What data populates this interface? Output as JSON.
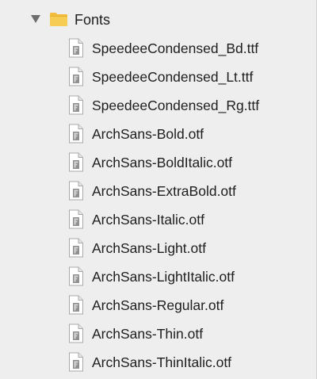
{
  "navigator": {
    "folder": {
      "name": "Fonts",
      "expanded": true,
      "icon": "folder-icon"
    },
    "files": [
      {
        "name": "SpeedeeCondensed_Bd.ttf",
        "icon": "font-file-icon"
      },
      {
        "name": "SpeedeeCondensed_Lt.ttf",
        "icon": "font-file-icon"
      },
      {
        "name": "SpeedeeCondensed_Rg.ttf",
        "icon": "font-file-icon"
      },
      {
        "name": "ArchSans-Bold.otf",
        "icon": "font-file-icon"
      },
      {
        "name": "ArchSans-BoldItalic.otf",
        "icon": "font-file-icon"
      },
      {
        "name": "ArchSans-ExtraBold.otf",
        "icon": "font-file-icon"
      },
      {
        "name": "ArchSans-Italic.otf",
        "icon": "font-file-icon"
      },
      {
        "name": "ArchSans-Light.otf",
        "icon": "font-file-icon"
      },
      {
        "name": "ArchSans-LightItalic.otf",
        "icon": "font-file-icon"
      },
      {
        "name": "ArchSans-Regular.otf",
        "icon": "font-file-icon"
      },
      {
        "name": "ArchSans-Thin.otf",
        "icon": "font-file-icon"
      },
      {
        "name": "ArchSans-ThinItalic.otf",
        "icon": "font-file-icon"
      }
    ]
  },
  "colors": {
    "background": "#eeeeee",
    "text": "#1e1e1e",
    "folder": "#f5c143",
    "disclosure": "#6e6e6e"
  }
}
